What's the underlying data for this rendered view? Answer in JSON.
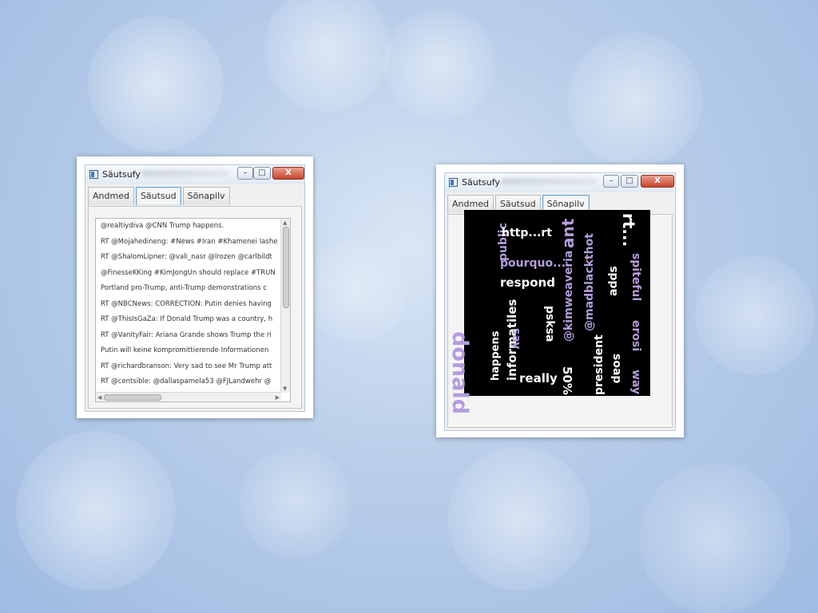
{
  "colors": {
    "cloud_background": "#000000",
    "cloud_word_white": "#ffffff",
    "cloud_word_purple": "#b39ddb",
    "close_button": "#c7452b",
    "active_tab_border": "#6aa7d6"
  },
  "window1": {
    "title": "Säutsufy",
    "buttons": {
      "minimize": "–",
      "maximize": "□",
      "close": "X"
    },
    "tabs": [
      {
        "label": "Andmed",
        "active": false
      },
      {
        "label": "Säutsud",
        "active": true
      },
      {
        "label": "Sõnapilv",
        "active": false
      }
    ],
    "tweets": [
      "@realtiydiva @CNN Trump happens.",
      "RT @Mojahedineng: #News #Iran #Khamenei lashe",
      "RT @ShalomLipner: @vali_nasr @lrozen @carlbildt",
      "@FinesseKKing #KimJongUn should replace #TRUN",
      "Portland pro-Trump, anti-Trump demonstrations c",
      "RT @NBCNews: CORRECTION: Putin denies having",
      "RT @ThisIsGaZa: If Donald Trump was a country, h",
      "RT @VanityFair: Ariana Grande shows Trump the ri",
      "Putin will keine kompromittierende Informationen",
      "RT @richardbranson: Very sad to see Mr Trump att",
      "RT @centsible: @dallaspamela53 @FJLandwehr @"
    ]
  },
  "window2": {
    "title": "Säutsufy",
    "buttons": {
      "minimize": "–",
      "maximize": "□",
      "close": "X"
    },
    "tabs": [
      {
        "label": "Andmed",
        "active": false
      },
      {
        "label": "Säutsud",
        "active": false
      },
      {
        "label": "Sõnapilv",
        "active": true
      }
    ],
    "word_cloud": [
      {
        "text": "donald",
        "color": "purple"
      },
      {
        "text": "happens",
        "color": "white"
      },
      {
        "text": "public",
        "color": "purple"
      },
      {
        "text": "informatiles",
        "color": "white"
      },
      {
        "text": "http...rt",
        "color": "white"
      },
      {
        "text": "pourquo...",
        "color": "purple"
      },
      {
        "text": "respond",
        "color": "white"
      },
      {
        "text": "say",
        "color": "purple"
      },
      {
        "text": "really",
        "color": "white"
      },
      {
        "text": "psksa",
        "color": "white"
      },
      {
        "text": "ant",
        "color": "purple"
      },
      {
        "text": "@kimweaveria",
        "color": "purple"
      },
      {
        "text": "50%",
        "color": "white"
      },
      {
        "text": "@madblackthot",
        "color": "purple"
      },
      {
        "text": "president",
        "color": "white"
      },
      {
        "text": "adds",
        "color": "white"
      },
      {
        "text": "soap",
        "color": "white"
      },
      {
        "text": "rt...",
        "color": "white"
      },
      {
        "text": "spiteful",
        "color": "purple"
      },
      {
        "text": "erosi",
        "color": "purple"
      },
      {
        "text": "way",
        "color": "purple"
      }
    ]
  }
}
